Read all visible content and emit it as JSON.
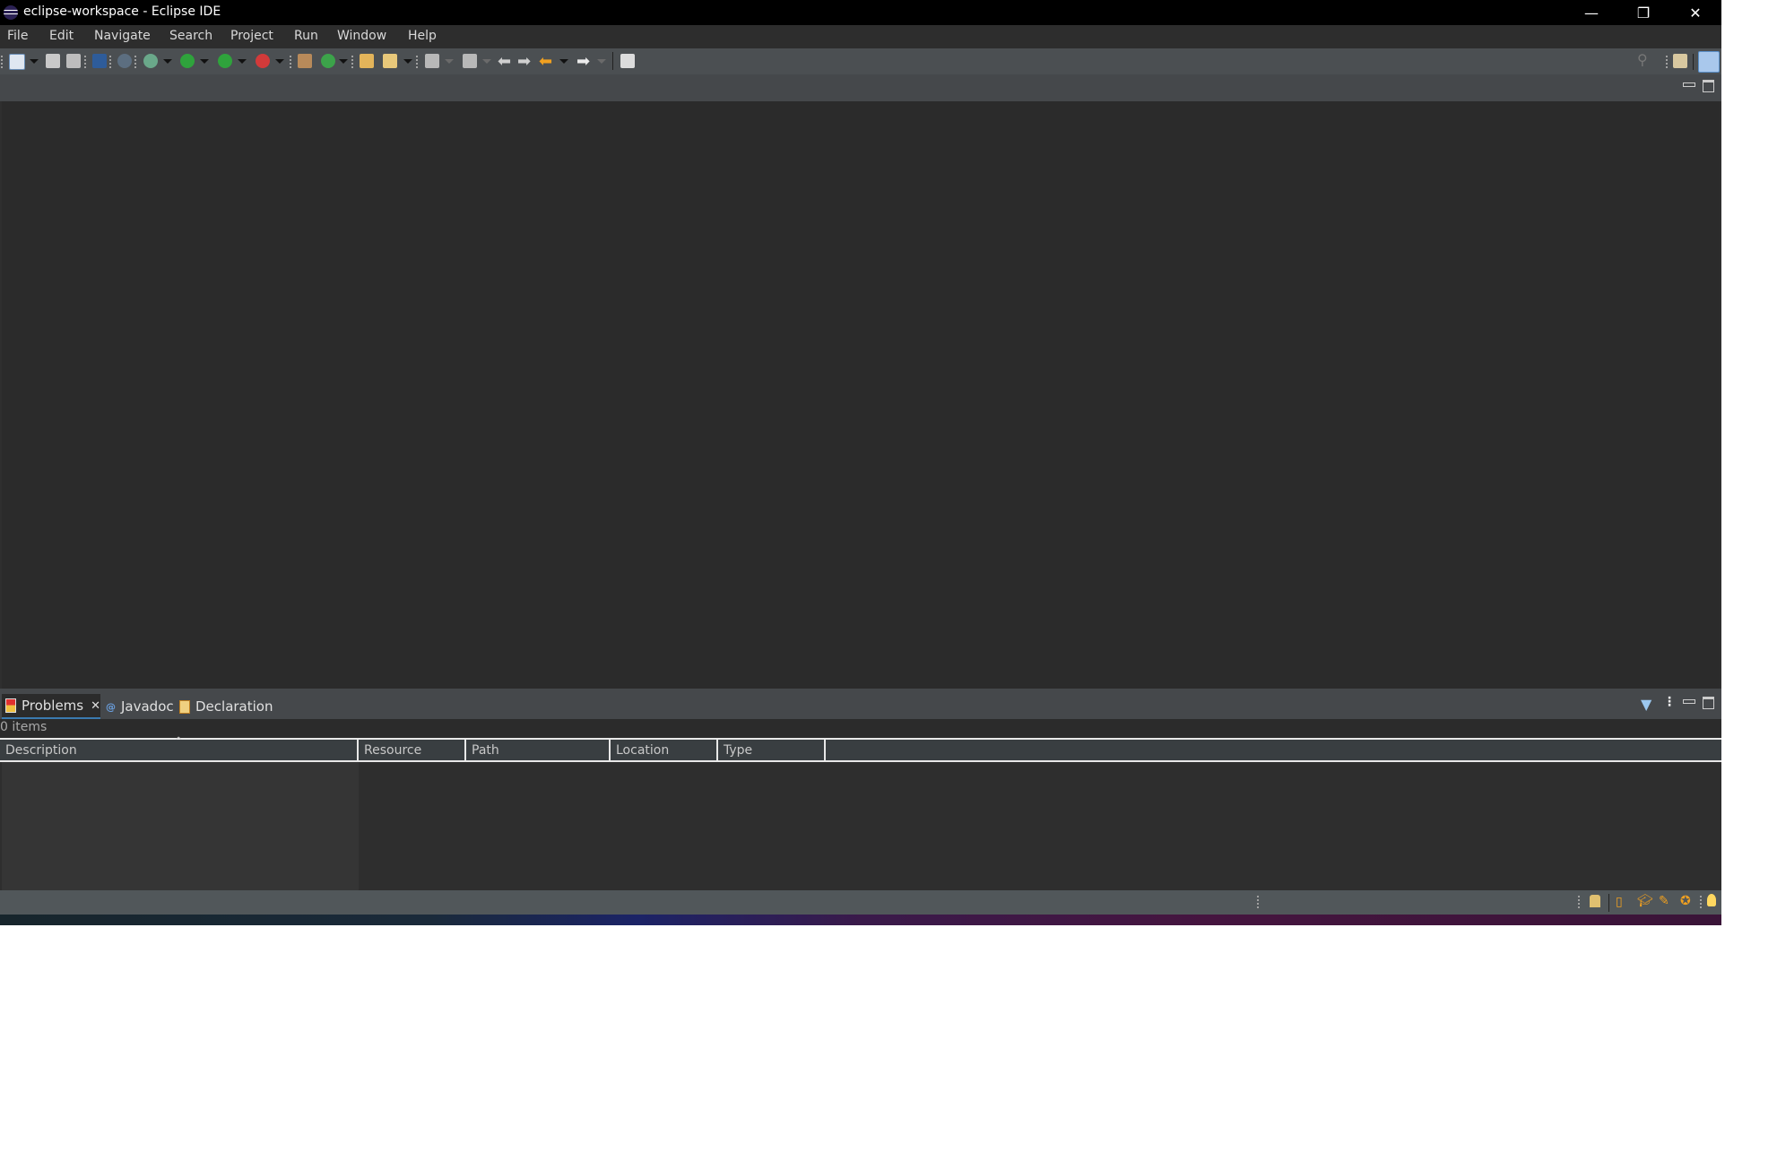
{
  "window": {
    "title": "eclipse-workspace - Eclipse IDE",
    "controls": {
      "minimize": "—",
      "restore": "❐",
      "close": "✕"
    }
  },
  "menubar": {
    "items": [
      "File",
      "Edit",
      "Navigate",
      "Search",
      "Project",
      "Run",
      "Window",
      "Help"
    ]
  },
  "toolbar": {
    "icons": [
      "new-wizard-icon",
      "save-icon",
      "save-all-icon",
      "terminal-icon",
      "skip-breakpoints-icon",
      "debug-icon",
      "run-icon",
      "coverage-icon",
      "external-tools-icon",
      "new-java-package-icon",
      "new-java-class-icon",
      "open-type-icon",
      "search-pen-icon",
      "next-annotation-icon",
      "previous-annotation-icon",
      "last-edit-location-icon",
      "back-icon",
      "forward-icon",
      "open-console-icon"
    ],
    "right_icons": [
      "search-icon",
      "open-perspective-icon",
      "java-perspective-icon"
    ]
  },
  "bottom_panel": {
    "tabs": [
      {
        "label": "Problems",
        "icon": "problems-icon",
        "active": true,
        "closable": true
      },
      {
        "label": "Javadoc",
        "icon": "javadoc-icon",
        "active": false
      },
      {
        "label": "Declaration",
        "icon": "declaration-icon",
        "active": false
      }
    ],
    "items_count": "0 items",
    "columns": [
      "Description",
      "Resource",
      "Path",
      "Location",
      "Type"
    ],
    "rows": []
  },
  "statusbar": {
    "icons": [
      "tip-icon",
      "overview-icon",
      "tutorials-icon",
      "samples-icon",
      "whats-new-icon",
      "lightbulb-icon"
    ]
  },
  "colors": {
    "background": "#2b2b2b",
    "toolbar": "#4b4f52",
    "accent": "#3a7ab0"
  }
}
